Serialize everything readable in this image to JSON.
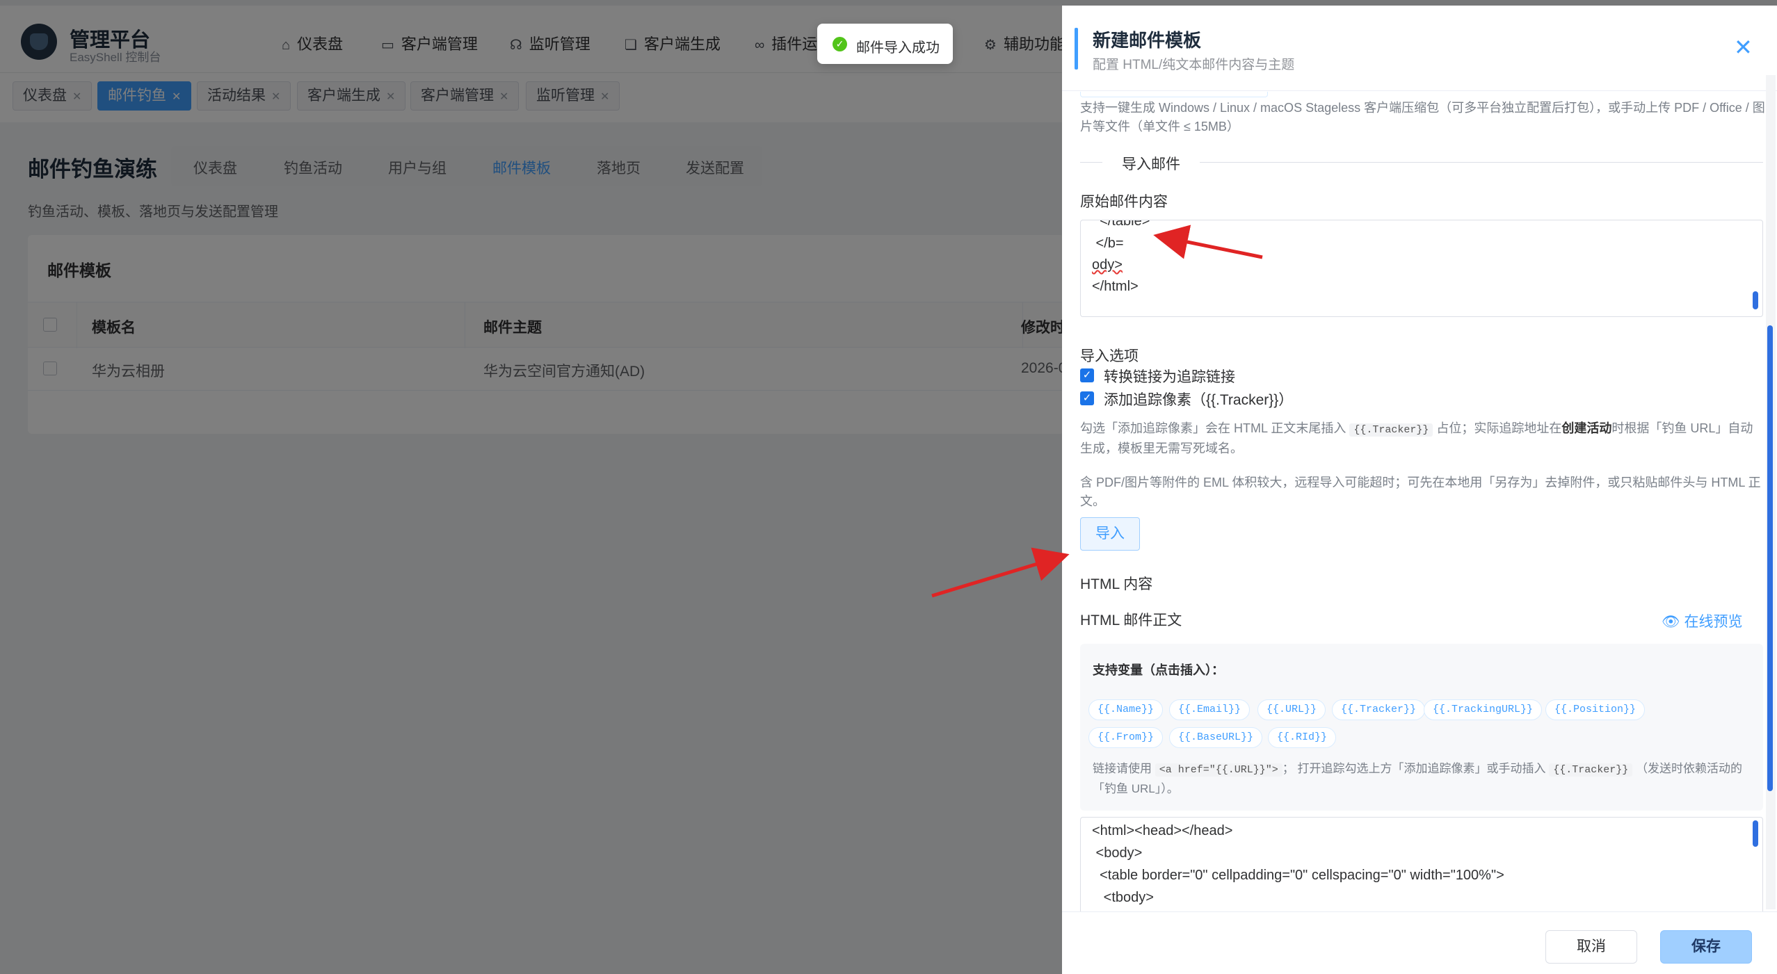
{
  "brand": {
    "title": "管理平台",
    "subtitle": "EasyShell 控制台"
  },
  "topnav": [
    {
      "icon": "home-icon",
      "label": "仪表盘"
    },
    {
      "icon": "monitor-icon",
      "label": "客户端管理"
    },
    {
      "icon": "headset-icon",
      "label": "监听管理"
    },
    {
      "icon": "layers-icon",
      "label": "客户端生成"
    },
    {
      "icon": "link-icon",
      "label": "插件运"
    },
    {
      "icon": "gear-icon",
      "label": "辅助功能"
    }
  ],
  "visited_tabs": [
    "仪表盘",
    "邮件钓鱼",
    "活动结果",
    "客户端生成",
    "客户端管理",
    "监听管理"
  ],
  "page": {
    "title": "邮件钓鱼演练",
    "tabs": [
      "仪表盘",
      "钓鱼活动",
      "用户与组",
      "邮件模板",
      "落地页",
      "发送配置"
    ],
    "active_tab": "邮件模板",
    "description": "钓鱼活动、模板、落地页与发送配置管理"
  },
  "templates_card": {
    "title": "邮件模板",
    "columns": [
      "模板名",
      "邮件主题",
      "修改时"
    ],
    "rows": [
      [
        "华为云相册",
        "华为云空间官方通知(AD)",
        "2026-0"
      ]
    ]
  },
  "toast": {
    "message": "邮件导入成功"
  },
  "drawer": {
    "title": "新建邮件模板",
    "subtitle": "配置 HTML/纯文本邮件内容与主题",
    "attach_help": "支持一键生成 Windows / Linux / macOS Stageless 客户端压缩包（可多平台独立配置后打包），或手动上传 PDF / Office / 图片等文件（单文件 ≤ 15MB）",
    "section_import": "导入邮件",
    "raw_label": "原始邮件内容",
    "raw_lines": [
      "  </table>",
      " </b=",
      "ody>",
      "</html>"
    ],
    "options_label": "导入选项",
    "option1": "转换链接为追踪链接",
    "option2": "添加追踪像素（{{.Tracker}}）",
    "note1_a": "勾选「添加追踪像素」会在 HTML 正文末尾插入",
    "note1_code": "{{.Tracker}}",
    "note1_b": "占位；实际追踪地址在",
    "note1_bold": "创建活动",
    "note1_c": "时根据「钓鱼 URL」自动生成，模板里无需写死域名。",
    "note2": "含 PDF/图片等附件的 EML 体积较大，远程导入可能超时；可先在本地用「另存为」去掉附件，或只粘贴邮件头与 HTML 正文。",
    "import_button": "导入",
    "html_section": "HTML 内容",
    "html_label": "HTML 邮件正文",
    "preview_link": "在线预览",
    "vars_title": "支持变量（点击插入）：",
    "vars": [
      "{{.Name}}",
      "{{.Email}}",
      "{{.URL}}",
      "{{.Tracker}}",
      "{{.TrackingURL}}",
      "{{.Position}}",
      "{{.From}}",
      "{{.BaseURL}}",
      "{{.RId}}"
    ],
    "var_note_a": "链接请使用",
    "var_note_code1": "<a href=\"{{.URL}}\">",
    "var_note_b": "； 打开追踪勾选上方「添加追踪像素」或手动插入",
    "var_note_code2": "{{.Tracker}}",
    "var_note_c": "（发送时依赖活动的「钓鱼 URL」）。",
    "html_lines": [
      "<html><head></head>",
      " <body>",
      "  <table border=\"0\" cellpadding=\"0\" cellspacing=\"0\" width=\"100%\">",
      "   <tbody>"
    ],
    "cancel": "取消",
    "save": "保存"
  },
  "colors": {
    "accent": "#409eff",
    "success": "#52c41a",
    "arrow": "#e02424"
  }
}
